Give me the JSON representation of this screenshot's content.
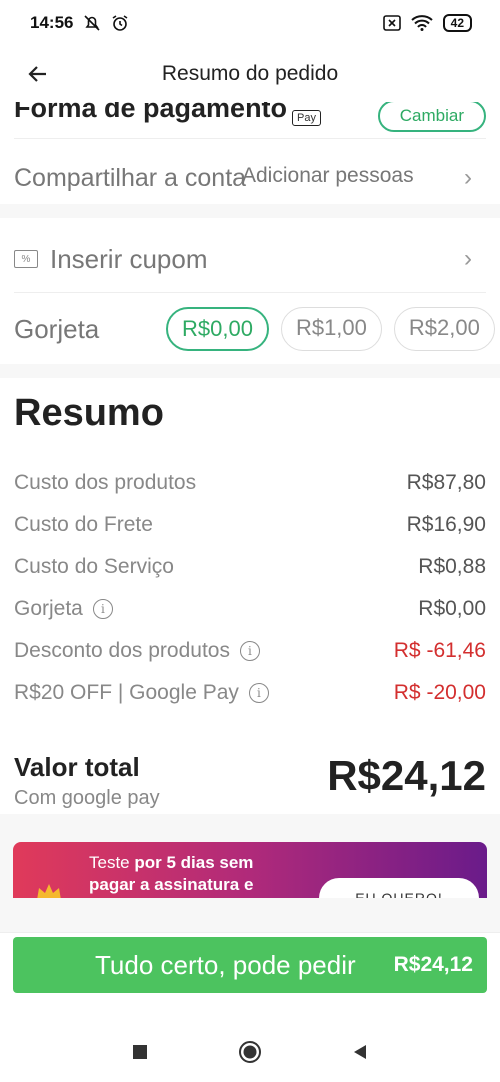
{
  "status_bar": {
    "time": "14:56",
    "battery": "42"
  },
  "header": {
    "title": "Resumo do pedido"
  },
  "payment": {
    "title": "Forma de pagamento",
    "badge": "Pay",
    "change_label": "Cambiar"
  },
  "share": {
    "title": "Compartilhar a conta",
    "add_label": "Adicionar pessoas"
  },
  "coupon": {
    "label": "Inserir cupom"
  },
  "tip": {
    "label": "Gorjeta",
    "options": [
      "R$0,00",
      "R$1,00",
      "R$2,00"
    ],
    "selected": "R$0,00"
  },
  "summary": {
    "title": "Resumo",
    "lines": [
      {
        "label": "Custo dos produtos",
        "value": "R$87,80",
        "info": false,
        "negative": false
      },
      {
        "label": "Custo do Frete",
        "value": "R$16,90",
        "info": false,
        "negative": false
      },
      {
        "label": "Custo do Serviço",
        "value": "R$0,88",
        "info": false,
        "negative": false
      },
      {
        "label": "Gorjeta",
        "value": "R$0,00",
        "info": true,
        "negative": false
      },
      {
        "label": "Desconto dos produtos",
        "value": "R$ -61,46",
        "info": true,
        "negative": true
      },
      {
        "label": "R$20 OFF | Google Pay",
        "value": "R$ -20,00",
        "info": true,
        "negative": true
      }
    ],
    "total_label": "Valor total",
    "total_sub": "Com google pay",
    "total_value": "R$24,12"
  },
  "promo": {
    "line1_plain": "Teste ",
    "line1_bold": "por 5 dias sem",
    "line2_bold": "pagar a assinatura e",
    "button_label": "EU QUERO!"
  },
  "action": {
    "label": "Tudo certo, pode pedir",
    "price": "R$24,12"
  },
  "colors": {
    "accent_green": "#4cc35f",
    "negative_red": "#d32f2f"
  }
}
